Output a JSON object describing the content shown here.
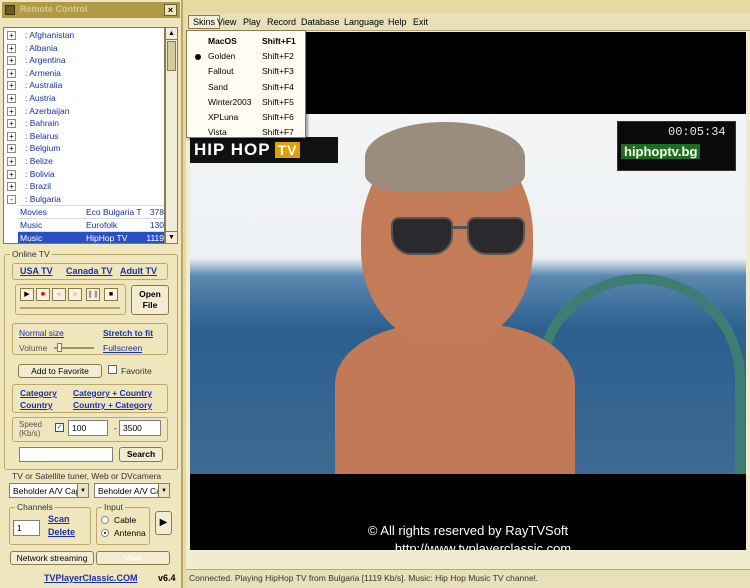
{
  "left_panel": {
    "title": "Remote Control",
    "countries": [
      {
        "sign": "+",
        "name": ": Afghanistan"
      },
      {
        "sign": "+",
        "name": ": Albania"
      },
      {
        "sign": "+",
        "name": ": Argentina"
      },
      {
        "sign": "+",
        "name": ": Armenia"
      },
      {
        "sign": "+",
        "name": ": Australia"
      },
      {
        "sign": "+",
        "name": ": Austria"
      },
      {
        "sign": "+",
        "name": ": Azerbaijan"
      },
      {
        "sign": "+",
        "name": ": Bahrain"
      },
      {
        "sign": "+",
        "name": ": Belarus"
      },
      {
        "sign": "+",
        "name": ": Belgium"
      },
      {
        "sign": "+",
        "name": ": Belize"
      },
      {
        "sign": "+",
        "name": ": Bolivia"
      },
      {
        "sign": "+",
        "name": ": Brazil"
      },
      {
        "sign": "-",
        "name": ": Bulgaria"
      }
    ],
    "channels": [
      {
        "category": "Movies",
        "name": "Eco Bulgaria T",
        "speed": "378"
      },
      {
        "category": "Music",
        "name": "Eurofolk",
        "speed": "130"
      },
      {
        "category": "Music",
        "name": "HipHop TV",
        "speed": "1119"
      }
    ],
    "online_tv": {
      "label": "Online TV",
      "usa": "USA TV",
      "canada": "Canada TV",
      "adult": "Adult TV",
      "open_file": "Open File",
      "normal_size": "Normal size",
      "stretch": "Stretch to fit",
      "volume": "Volume",
      "fullscreen": "Fullscreen",
      "add_favorite": "Add to Favorite",
      "favorite": "Favorite",
      "category": "Category",
      "category_country": "Category + Country",
      "country": "Country",
      "country_category": "Country + Category",
      "speed_label": "Speed (Kb/s)",
      "speed_min": "100",
      "speed_sep": "-",
      "speed_max": "3500",
      "search": "Search"
    },
    "tuner": {
      "label": "TV or Satellite tuner, Web or DVcamera",
      "device1": "Beholder A/V Cap",
      "device2": "Beholder A/V Ca",
      "channels_label": "Channels",
      "channel_value": "1",
      "scan": "Scan",
      "delete": "Delete",
      "input_label": "Input",
      "cable": "Cable",
      "antenna": "Antenna",
      "network": "Network streaming",
      "view": "View"
    },
    "footer_link": "TVPlayerClassic.COM",
    "version": "v6.4"
  },
  "menu": {
    "items": [
      "Skins",
      "View",
      "Play",
      "Record",
      "Database",
      "Language",
      "Help",
      "Exit"
    ]
  },
  "skins": [
    {
      "name": "MacOS",
      "key": "Shift+F1",
      "bold": true,
      "selected": false
    },
    {
      "name": "Golden",
      "key": "Shift+F2",
      "bold": false,
      "selected": true
    },
    {
      "name": "Fallout",
      "key": "Shift+F3",
      "bold": false,
      "selected": false
    },
    {
      "name": "Sand",
      "key": "Shift+F4",
      "bold": false,
      "selected": false
    },
    {
      "name": "Winter2003",
      "key": "Shift+F5",
      "bold": false,
      "selected": false
    },
    {
      "name": "XPLuna",
      "key": "Shift+F6",
      "bold": false,
      "selected": false
    },
    {
      "name": "Vista",
      "key": "Shift+F7",
      "bold": false,
      "selected": false
    }
  ],
  "video": {
    "logo": "HIP HOP",
    "logo_tv": "TV",
    "timecode": "00:05:34",
    "watermark": "hiphoptv.bg",
    "copyright": "© All rights reserved by RayTVSoft",
    "url": "http://www.tvplayerclassic.com"
  },
  "status": "Connected. Playing HipHop TV from Bulgaria [1119 Kb/s]. Music: Hip Hop Music TV channel.",
  "colors": {
    "accent": "#b09a48",
    "link": "#1a2faa",
    "selection": "#2a4fc0"
  }
}
